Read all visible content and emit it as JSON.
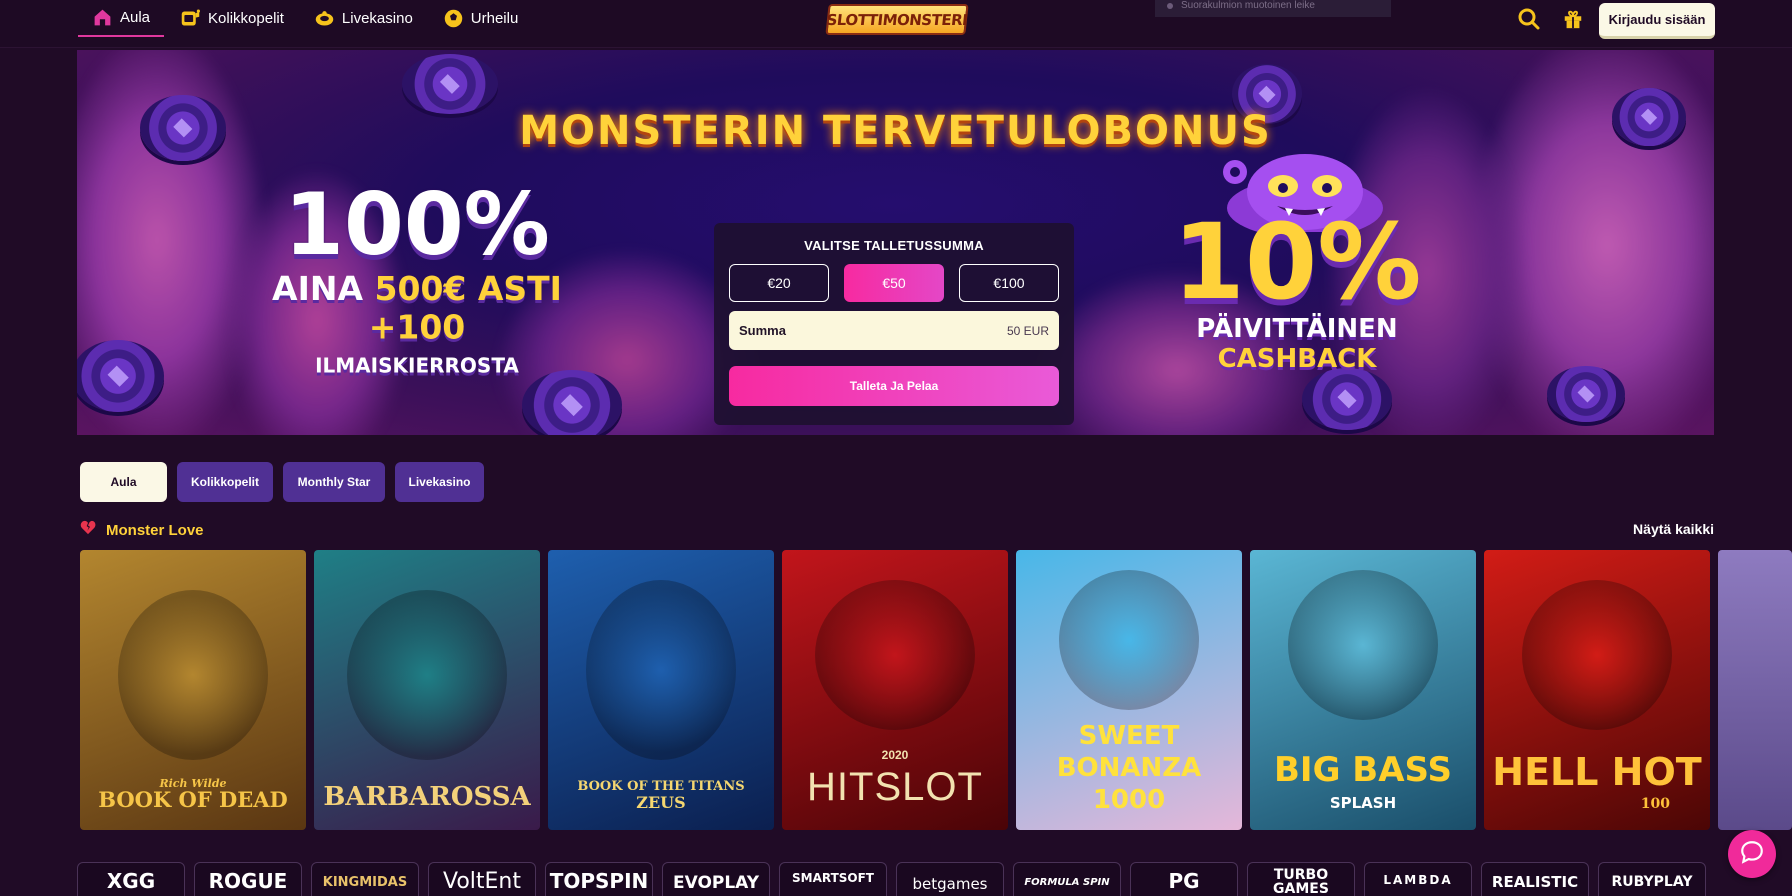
{
  "nav": {
    "items": [
      {
        "label": "Aula",
        "icon": "home-icon",
        "active": true
      },
      {
        "label": "Kolikkopelit",
        "icon": "slot-machine-icon",
        "active": false
      },
      {
        "label": "Livekasino",
        "icon": "live-casino-icon",
        "active": false
      },
      {
        "label": "Urheilu",
        "icon": "sports-ball-icon",
        "active": false
      }
    ],
    "logo_text": "SLOTTIMONSTERI",
    "snippet_text": "Suorakulmion muotoinen leike",
    "search_icon": "search-icon",
    "gift_icon": "gift-icon",
    "login_label": "Kirjaudu sisään"
  },
  "banner": {
    "title": "MONSTERIN TERVETULOBONUS",
    "left_big": "100%",
    "left_line2_prefix": "AINA ",
    "left_line2_highlight": "500€ ASTI",
    "left_line3_number": "+100",
    "left_line3_text": "ILMAISKIERROSTA",
    "right_big": "10%",
    "right_line2": "PÄIVITTÄINEN",
    "right_line3": "CASHBACK"
  },
  "deposit": {
    "title": "VALITSE TALLETUSSUMMA",
    "amounts": [
      {
        "label": "€20",
        "selected": false
      },
      {
        "label": "€50",
        "selected": true
      },
      {
        "label": "€100",
        "selected": false
      }
    ],
    "sum_label": "Summa",
    "sum_value": "50 EUR",
    "button_label": "Talleta Ja Pelaa"
  },
  "filters": [
    {
      "label": "Aula",
      "active": true
    },
    {
      "label": "Kolikkopelit",
      "active": false
    },
    {
      "label": "Monthly Star",
      "active": false
    },
    {
      "label": "Livekasino",
      "active": false
    }
  ],
  "section": {
    "icon": "broken-heart-icon",
    "title": "Monster Love",
    "see_all": "Näytä kaikki"
  },
  "games": [
    {
      "title": "BOOK OF DEAD",
      "subtitle": "Rich Wilde",
      "bg1": "#b3862f",
      "bg2": "#5a3612",
      "title_color": "#f6c548"
    },
    {
      "title": "BARBAROSSA",
      "subtitle": "",
      "bg1": "#1f7f86",
      "bg2": "#3a1a4a",
      "title_color": "#f3d17a"
    },
    {
      "title": "BOOK OF THE TITANS",
      "subtitle": "ZEUS",
      "bg1": "#1e5fae",
      "bg2": "#0b1f4f",
      "title_color": "#f5d770"
    },
    {
      "title": "HITSLOT",
      "subtitle": "2020",
      "bg1": "#c2151b",
      "bg2": "#4a0407",
      "title_color": "#f2e2b0"
    },
    {
      "title": "SWEET BONANZA 1000",
      "subtitle": "",
      "bg1": "#48b7e8",
      "bg2": "#e5b7d9",
      "title_color": "#ffe23c"
    },
    {
      "title": "BIG BASS",
      "subtitle": "SPLASH",
      "bg1": "#5ab6d4",
      "bg2": "#1a4e6a",
      "title_color": "#ffcf2a"
    },
    {
      "title": "HELL HOT",
      "subtitle": "100",
      "bg1": "#d21c16",
      "bg2": "#4b0605",
      "title_color": "#ffc23a"
    }
  ],
  "providers": [
    "XGG",
    "ROGUE",
    "KINGMIDAS",
    "VoltEnt",
    "TOPSPIN",
    "EVOPLAY",
    "SMARTSOFT",
    "betgames",
    "FORMULA SPIN",
    "PG",
    "TURBO GAMES",
    "LAMBDA",
    "REALISTIC",
    "RUBYPLAY"
  ],
  "chat_icon": "chat-bubble-icon"
}
